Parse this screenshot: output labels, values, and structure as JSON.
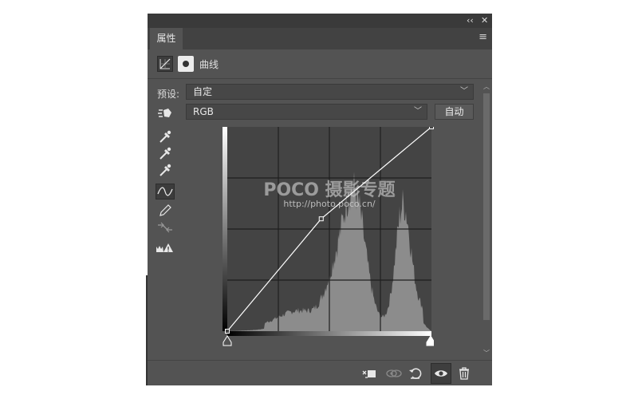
{
  "panel": {
    "tab_label": "属性",
    "collapse_label": "‹‹",
    "close_label": "✕",
    "menu_label": "≡",
    "title": "曲线"
  },
  "preset": {
    "label": "预设:",
    "value": "自定"
  },
  "channel": {
    "value": "RGB",
    "auto_label": "自动"
  },
  "tools": [
    "on-image-adjust-icon",
    "black-point-eyedropper-icon",
    "gray-point-eyedropper-icon",
    "white-point-eyedropper-icon",
    "curve-edit-icon",
    "pencil-draw-icon",
    "smooth-curve-icon",
    "clipping-warning-icon"
  ],
  "watermark": {
    "brand": "POCO 摄影专题",
    "url": "http://photo.poco.cn/"
  },
  "curve": {
    "points": [
      [
        0,
        0
      ],
      [
        0.46,
        0.55
      ],
      [
        1,
        1
      ]
    ],
    "input_range": [
      0,
      255
    ],
    "output_range": [
      0,
      255
    ]
  },
  "footer_icons": [
    "clip-to-layer-icon",
    "view-previous-icon",
    "reset-icon",
    "visibility-eye-icon",
    "delete-trash-icon"
  ],
  "colors": {
    "panel_bg": "#535353",
    "graph_bg": "#444444",
    "histogram": "#8c8c8c",
    "curve_line": "#ffffff"
  }
}
